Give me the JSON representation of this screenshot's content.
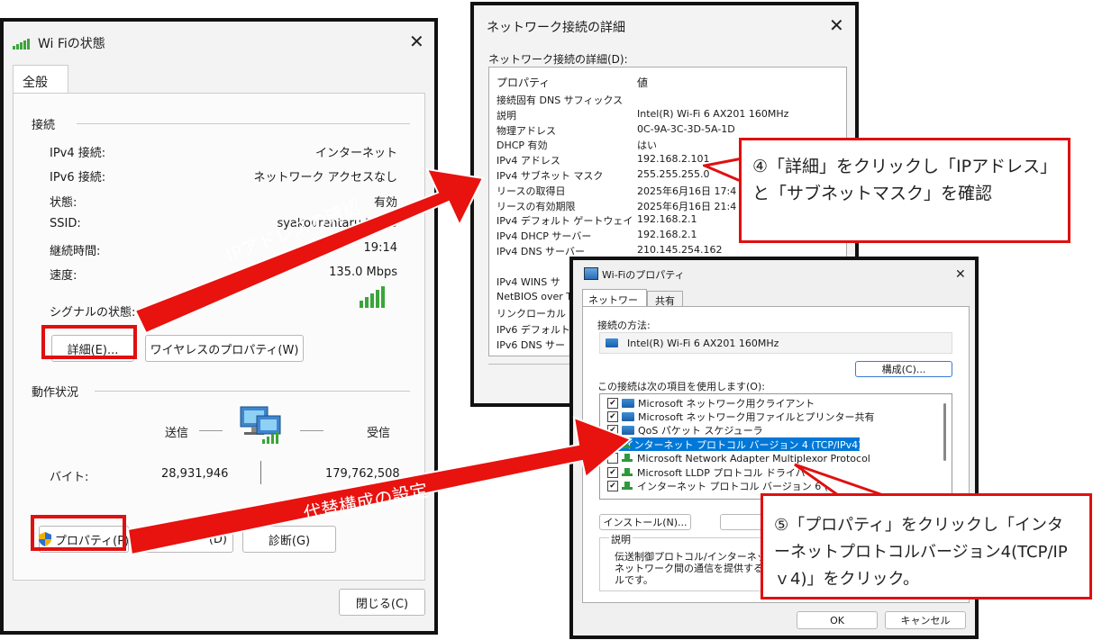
{
  "wifi_status": {
    "title": "Wi Fiの状態",
    "tab": "全般",
    "connection_section": "接続",
    "rows": [
      {
        "label": "IPv4 接続:",
        "value": "インターネット"
      },
      {
        "label": "IPv6 接続:",
        "value": "ネットワーク アクセスなし"
      },
      {
        "label": "状態:",
        "value": "有効"
      },
      {
        "label": "SSID:",
        "value": "syakourentaru tokyo"
      },
      {
        "label": "継続時間:",
        "value": "19:14"
      },
      {
        "label": "速度:",
        "value": "135.0 Mbps"
      }
    ],
    "signal_label": "シグナルの状態:",
    "details_button": "詳細(E)...",
    "wireless_props_button": "ワイヤレスのプロパティ(W)",
    "activity_section": "動作状況",
    "sent_label": "送信",
    "received_label": "受信",
    "bytes_label": "バイト:",
    "bytes_sent": "28,931,946",
    "bytes_received": "179,762,508",
    "properties_button": "プロパティ(P)",
    "disable_button_partial": "(D)",
    "diagnose_button": "診断(G)",
    "close_button": "閉じる(C)"
  },
  "net_details": {
    "title": "ネットワーク接続の詳細",
    "subtitle": "ネットワーク接続の詳細(D):",
    "col_property": "プロパティ",
    "col_value": "値",
    "rows": [
      {
        "p": "接続固有 DNS サフィックス",
        "v": ""
      },
      {
        "p": "説明",
        "v": "Intel(R) Wi-Fi 6 AX201 160MHz"
      },
      {
        "p": "物理アドレス",
        "v": "0C-9A-3C-3D-5A-1D"
      },
      {
        "p": "DHCP 有効",
        "v": "はい"
      },
      {
        "p": "IPv4 アドレス",
        "v": "192.168.2.101"
      },
      {
        "p": "IPv4 サブネット マスク",
        "v": "255.255.255.0"
      },
      {
        "p": "リースの取得日",
        "v": "2025年6月16日 17:4"
      },
      {
        "p": "リースの有効期限",
        "v": "2025年6月16日 21:4"
      },
      {
        "p": "IPv4 デフォルト ゲートウェイ",
        "v": "192.168.2.1"
      },
      {
        "p": "IPv4 DHCP サーバー",
        "v": "192.168.2.1"
      },
      {
        "p": "IPv4 DNS サーバー",
        "v": "210.145.254.162"
      }
    ],
    "rows_lower": [
      "IPv4 WINS サ",
      "NetBIOS over T",
      "リンクローカル IPv",
      "IPv6 デフォルト",
      "IPv6 DNS サー"
    ]
  },
  "wifi_props": {
    "title": "Wi-Fiのプロパティ",
    "tab_network": "ネットワーク",
    "tab_share": "共有",
    "connect_using_label": "接続の方法:",
    "adapter": "Intel(R) Wi-Fi 6 AX201 160MHz",
    "configure_button": "構成(C)...",
    "items_label": "この接続は次の項目を使用します(O):",
    "items": [
      {
        "label": "Microsoft ネットワーク用クライアント",
        "checked": "✔",
        "icon": "network"
      },
      {
        "label": "Microsoft ネットワーク用ファイルとプリンター共有",
        "checked": "✔",
        "icon": "network"
      },
      {
        "label": "QoS パケット スケジューラ",
        "checked": "✔",
        "icon": "network"
      },
      {
        "label": "インターネット プロトコル バージョン 4 (TCP/IPv4)",
        "checked": "✔",
        "icon": "protocol"
      },
      {
        "label": "Microsoft Network Adapter Multiplexor Protocol",
        "checked": "",
        "icon": "protocol"
      },
      {
        "label": "Microsoft LLDP プロトコル ドライバー",
        "checked": "✔",
        "icon": "protocol"
      },
      {
        "label": "インターネット プロトコル バージョン 6 (T",
        "checked": "✔",
        "icon": "protocol"
      }
    ],
    "install_button": "インストール(N)...",
    "desc_label": "説明",
    "desc_text_1": "伝送制御プロトコル/インターネット",
    "desc_text_2": "ネットワーク間の通信を提供する、",
    "desc_text_3": "ルです。",
    "ok_button": "OK",
    "cancel_button": "キャンセル"
  },
  "annotations": {
    "arrow1_text": "IPアドレスの確認",
    "arrow2_text": "代替構成の設定",
    "callout1": "④「詳細」をクリックし「IPアドレス」と「サブネットマスク」を確認",
    "callout2": "⑤「プロパティ」をクリックし「インターネットプロトコルバージョン4(TCP/IPｖ4)」をクリック。"
  },
  "colors": {
    "accent_red": "#e01010",
    "selection_blue": "#0078d7",
    "signal_green": "#3aa53a"
  }
}
